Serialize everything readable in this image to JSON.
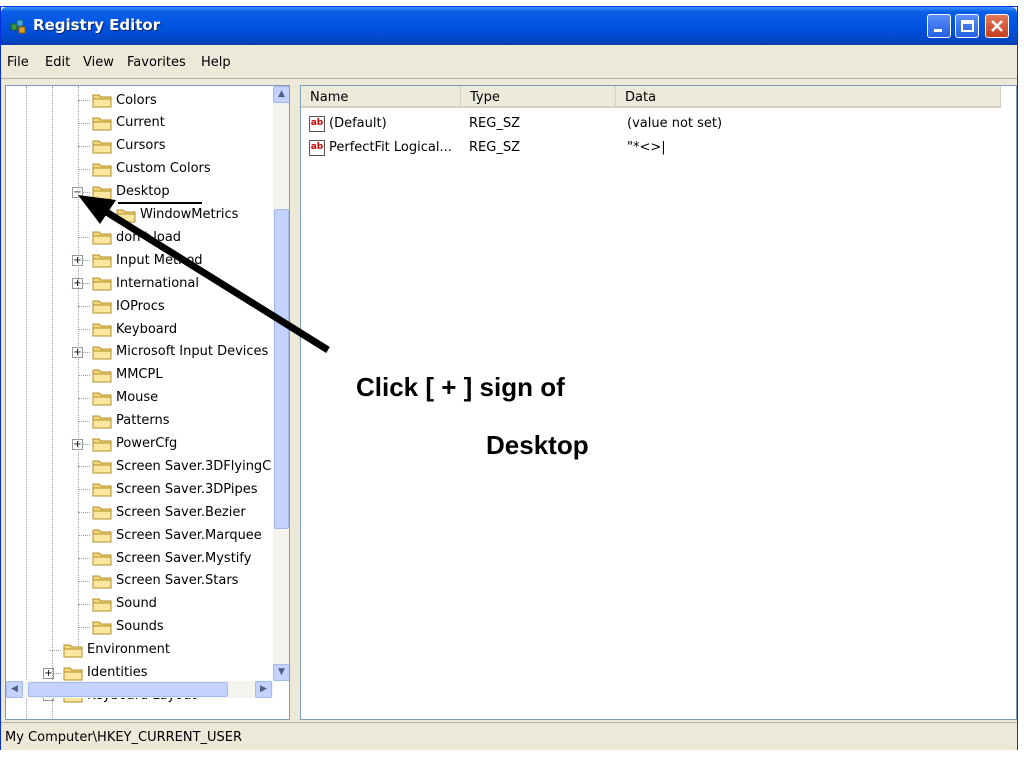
{
  "window": {
    "title": "Registry Editor",
    "icon": "registry-icon"
  },
  "menu": [
    "File",
    "Edit",
    "View",
    "Favorites",
    "Help"
  ],
  "tree": {
    "items": [
      {
        "label": "Colors"
      },
      {
        "label": "Current"
      },
      {
        "label": "Cursors"
      },
      {
        "label": "Custom Colors"
      },
      {
        "label": "Desktop",
        "expanded": true,
        "selected": true
      },
      {
        "label": "WindowMetrics",
        "child": true
      },
      {
        "label": "don't load"
      },
      {
        "label": "Input Method",
        "expandable": true
      },
      {
        "label": "International",
        "expandable": true
      },
      {
        "label": "IOProcs"
      },
      {
        "label": "Keyboard"
      },
      {
        "label": "Microsoft Input Devices",
        "expandable": true
      },
      {
        "label": "MMCPL"
      },
      {
        "label": "Mouse"
      },
      {
        "label": "Patterns"
      },
      {
        "label": "PowerCfg",
        "expandable": true
      },
      {
        "label": "Screen Saver.3DFlyingC"
      },
      {
        "label": "Screen Saver.3DPipes"
      },
      {
        "label": "Screen Saver.Bezier"
      },
      {
        "label": "Screen Saver.Marquee"
      },
      {
        "label": "Screen Saver.Mystify"
      },
      {
        "label": "Screen Saver.Stars"
      },
      {
        "label": "Sound"
      },
      {
        "label": "Sounds"
      },
      {
        "label": "Environment",
        "level": "up"
      },
      {
        "label": "Identities",
        "level": "up",
        "expandable": true
      },
      {
        "label": "Keyboard Layout",
        "level": "up",
        "expandable": true
      }
    ]
  },
  "list": {
    "columns": [
      "Name",
      "Type",
      "Data"
    ],
    "rows": [
      {
        "name": "(Default)",
        "type": "REG_SZ",
        "data": "(value not set)"
      },
      {
        "name": "PerfectFit Logical...",
        "type": "REG_SZ",
        "data": "\"*<>|"
      }
    ]
  },
  "status": "My Computer\\HKEY_CURRENT_USER",
  "annotation": {
    "line1": "Click [ + ] sign of",
    "line2": "Desktop"
  }
}
